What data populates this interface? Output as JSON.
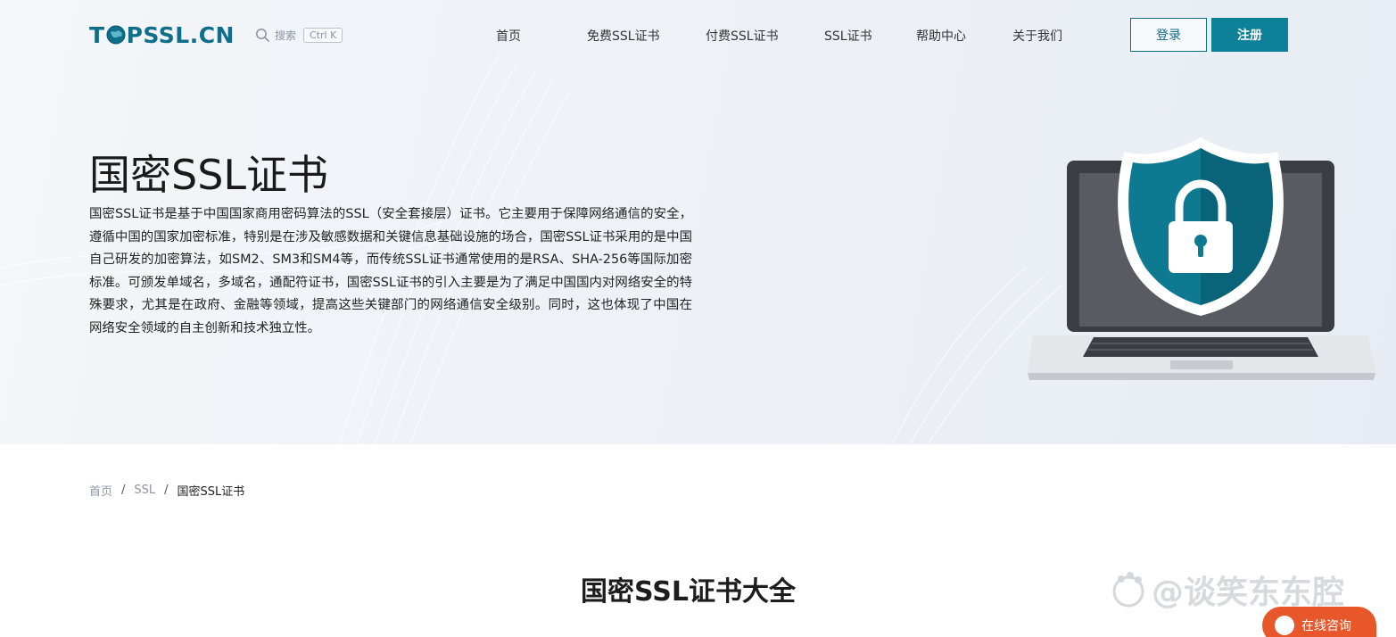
{
  "header": {
    "logo_text_before": "T",
    "logo_text_after": "PSSL.CN",
    "search_label": "搜索",
    "search_shortcut": "Ctrl K",
    "nav": [
      {
        "label": "首页"
      },
      {
        "label": "免费SSL证书"
      },
      {
        "label": "付费SSL证书"
      },
      {
        "label": "SSL证书"
      },
      {
        "label": "帮助中心"
      },
      {
        "label": "关于我们"
      }
    ],
    "login_label": "登录",
    "register_label": "注册"
  },
  "hero": {
    "title": "国密SSL证书",
    "description": "国密SSL证书是基于中国国家商用密码算法的SSL（安全套接层）证书。它主要用于保障网络通信的安全，遵循中国的国家加密标准，特别是在涉及敏感数据和关键信息基础设施的场合，国密SSL证书采用的是中国自己研发的加密算法，如SM2、SM3和SM4等，而传统SSL证书通常使用的是RSA、SHA-256等国际加密标准。可颁发单域名，多域名，通配符证书，国密SSL证书的引入主要是为了满足中国国内对网络安全的特殊要求，尤其是在政府、金融等领域，提高这些关键部门的网络通信安全级别。同时，这也体现了中国在网络安全领域的自主创新和技术独立性。"
  },
  "breadcrumb": {
    "items": [
      "首页",
      "SSL",
      "国密SSL证书"
    ]
  },
  "section": {
    "title": "国密SSL证书大全"
  },
  "watermark": {
    "text": "@谈笑东东腔"
  },
  "consult": {
    "label": "在线咨询"
  },
  "colors": {
    "brand": "#0d8197",
    "logo": "#0f6e8a",
    "consult": "#e7572a"
  }
}
